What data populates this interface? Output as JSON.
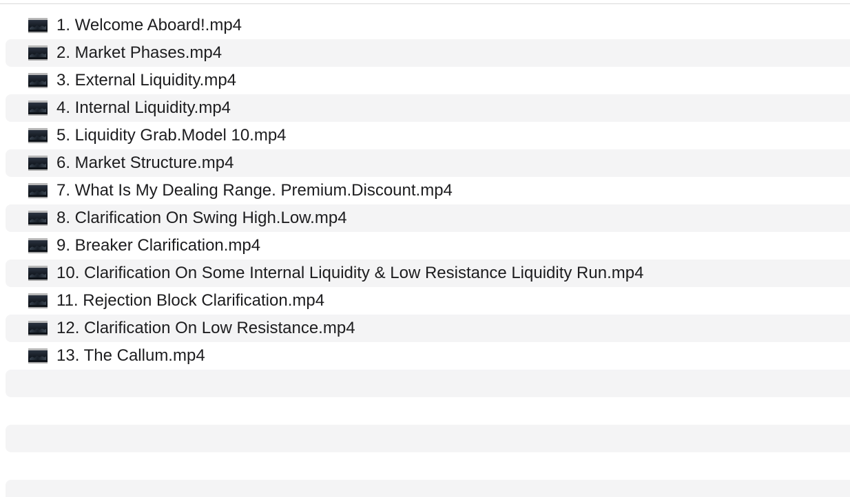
{
  "files": [
    {
      "name": "1. Welcome Aboard!.mp4",
      "icon": "video-thumbnail-icon"
    },
    {
      "name": "2. Market Phases.mp4",
      "icon": "video-thumbnail-icon"
    },
    {
      "name": "3. External Liquidity.mp4",
      "icon": "video-thumbnail-icon"
    },
    {
      "name": "4. Internal Liquidity.mp4",
      "icon": "video-thumbnail-icon"
    },
    {
      "name": "5. Liquidity Grab.Model 10.mp4",
      "icon": "video-thumbnail-icon"
    },
    {
      "name": "6. Market Structure.mp4",
      "icon": "video-thumbnail-icon"
    },
    {
      "name": "7. What Is My Dealing Range. Premium.Discount.mp4",
      "icon": "video-thumbnail-icon"
    },
    {
      "name": "8. Clarification On Swing High.Low.mp4",
      "icon": "video-thumbnail-icon"
    },
    {
      "name": "9. Breaker Clarification.mp4",
      "icon": "video-thumbnail-icon"
    },
    {
      "name": "10. Clarification On Some Internal Liquidity & Low Resistance Liquidity Run.mp4",
      "icon": "video-thumbnail-icon"
    },
    {
      "name": "11. Rejection Block Clarification.mp4",
      "icon": "video-thumbnail-icon"
    },
    {
      "name": "12. Clarification On Low Resistance.mp4",
      "icon": "video-thumbnail-icon"
    },
    {
      "name": "13. The Callum.mp4",
      "icon": "video-thumbnail-icon"
    }
  ],
  "colors": {
    "row_alt": "#f4f4f5",
    "text": "#1d1d1f"
  }
}
